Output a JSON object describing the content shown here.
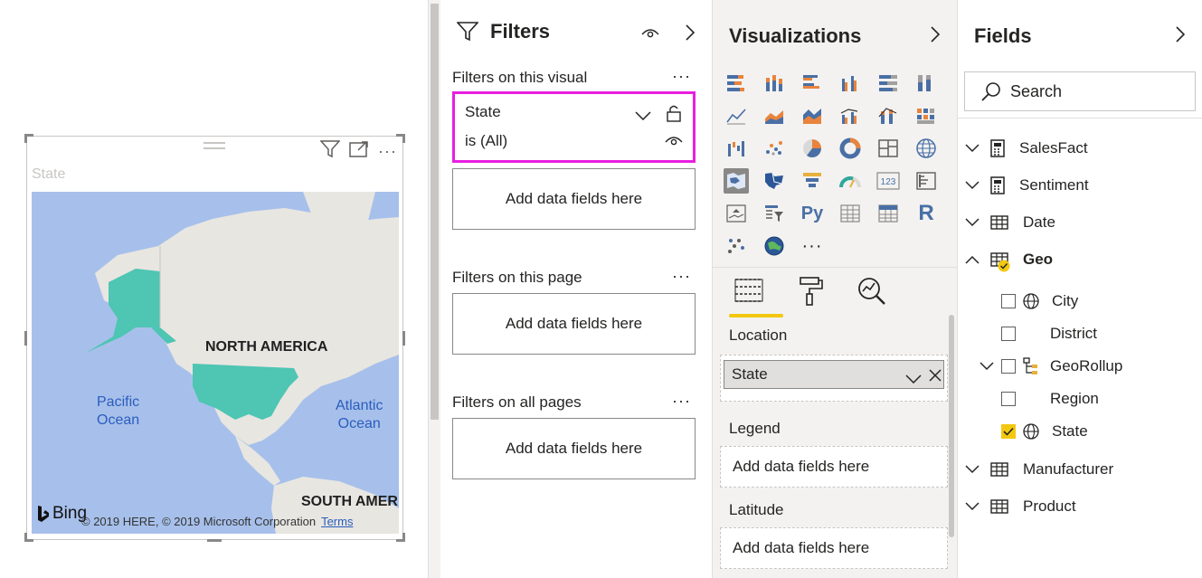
{
  "visual": {
    "title": "State",
    "map": {
      "north_america": "NORTH AMERICA",
      "south_america": "SOUTH AMER",
      "pacific": "Pacific\nOcean",
      "pacific_line1": "Pacific",
      "pacific_line2": "Ocean",
      "atlantic_line1": "Atlantic",
      "atlantic_line2": "Ocean",
      "bing": "Bing",
      "copyright": "© 2019 HERE, © 2019 Microsoft Corporation",
      "terms": "Terms"
    }
  },
  "filters": {
    "title": "Filters",
    "on_visual": {
      "label": "Filters on this visual",
      "card": {
        "field": "State",
        "condition": "is (All)"
      },
      "placeholder": "Add data fields here"
    },
    "on_page": {
      "label": "Filters on this page",
      "placeholder": "Add data fields here"
    },
    "on_all": {
      "label": "Filters on all pages",
      "placeholder": "Add data fields here"
    },
    "more": "···"
  },
  "visualizations": {
    "title": "Visualizations",
    "more_icon_label": "···",
    "python_label": "Py",
    "r_label": "R",
    "card_label": "123",
    "wells": {
      "location": {
        "label": "Location",
        "value": "State"
      },
      "legend": {
        "label": "Legend",
        "placeholder": "Add data fields here"
      },
      "latitude": {
        "label": "Latitude",
        "placeholder": "Add data fields here"
      }
    }
  },
  "fields": {
    "title": "Fields",
    "search_placeholder": "Search",
    "tables": {
      "salesfact": "SalesFact",
      "sentiment": "Sentiment",
      "date": "Date",
      "geo": "Geo",
      "manufacturer": "Manufacturer",
      "product": "Product"
    },
    "geo_fields": {
      "city": "City",
      "district": "District",
      "georollup": "GeoRollup",
      "region": "Region",
      "state": "State"
    }
  },
  "colors": {
    "accent_yellow": "#f2c811",
    "filter_highlight": "#e81ee0",
    "map_fill": "#4fc5b3",
    "map_water": "#a7c0eb"
  }
}
